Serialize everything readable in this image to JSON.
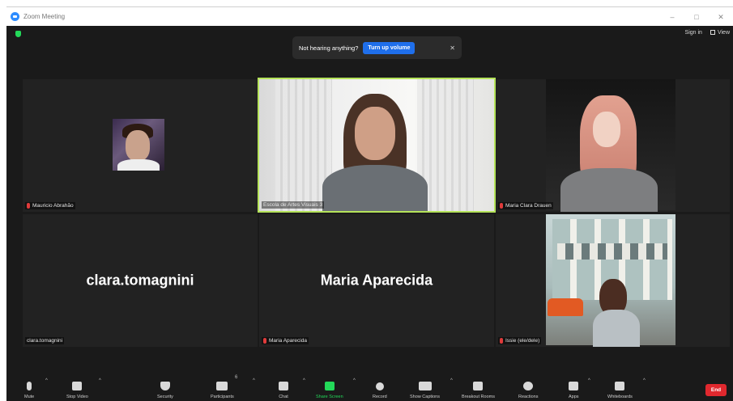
{
  "window": {
    "title": "Zoom Meeting",
    "controls": [
      "–",
      "□",
      "✕"
    ]
  },
  "top_right": {
    "sign_in": "Sign in",
    "view": "View"
  },
  "banner": {
    "message": "Not hearing anything?",
    "button": "Turn up volume",
    "close": "✕"
  },
  "tiles": [
    {
      "name": "Mauricio Abrahão",
      "muted": true,
      "type": "avatar"
    },
    {
      "name": "Escola de Artes Visuais 3",
      "muted": false,
      "type": "video",
      "active": true
    },
    {
      "name": "Maria Clara Drauen",
      "muted": true,
      "type": "video"
    },
    {
      "name": "clara.tomagnini",
      "display_name": "clara.tomagnini",
      "muted": false,
      "type": "name"
    },
    {
      "name": "Maria Aparecida",
      "display_name": "Maria Aparecida",
      "muted": true,
      "type": "name"
    },
    {
      "name": "Issie (ele/dele)",
      "muted": true,
      "type": "video"
    }
  ],
  "toolbar": {
    "mute": "Mute",
    "stop_video": "Stop Video",
    "security": "Security",
    "participants": "Participants",
    "participants_count": "6",
    "chat": "Chat",
    "share_screen": "Share Screen",
    "record": "Record",
    "show_captions": "Show Captions",
    "breakout_rooms": "Breakout Rooms",
    "reactions": "Reactions",
    "apps": "Apps",
    "whiteboards": "Whiteboards",
    "end": "End"
  },
  "colors": {
    "active_border": "#b5e35a",
    "accent": "#1f6feb",
    "share_green": "#23d959",
    "end_red": "#e0282e"
  }
}
